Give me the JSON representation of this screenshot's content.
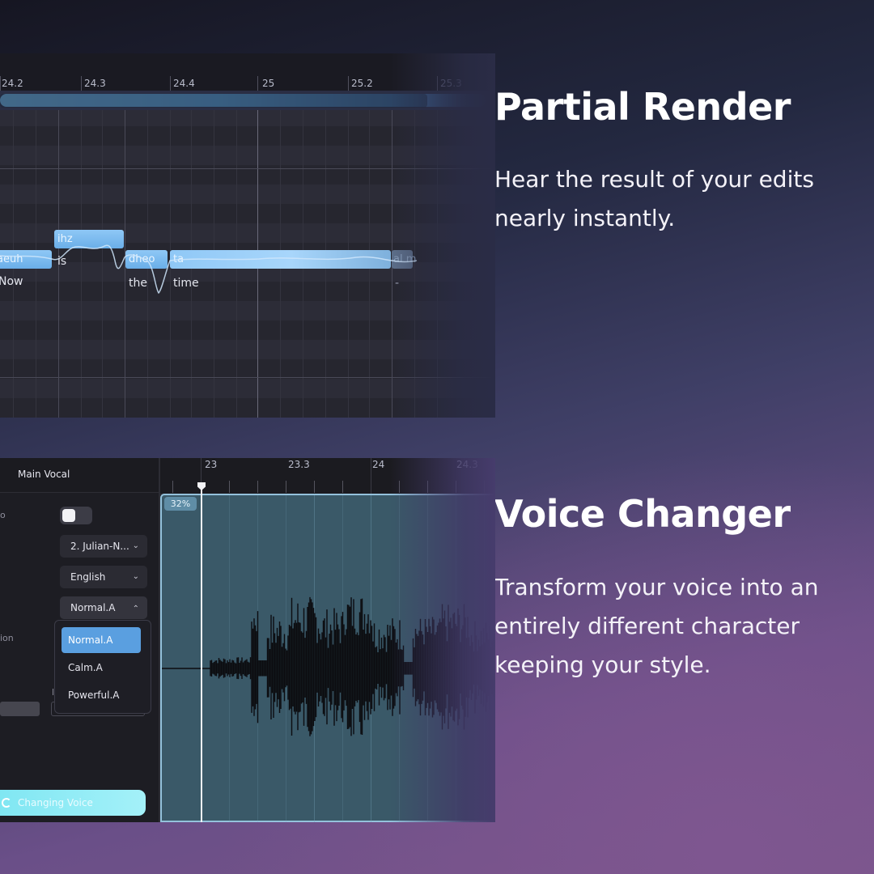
{
  "partial_render": {
    "heading": "Partial Render",
    "description": "Hear the result of your edits nearly instantly.",
    "ruler_ticks": [
      "24.2",
      "24.3",
      "24.4",
      "25",
      "25.2",
      "25.3"
    ],
    "notes": [
      {
        "label": "aeuh"
      },
      {
        "label": "ihz"
      },
      {
        "label": "dheo"
      },
      {
        "label": "ta"
      },
      {
        "label": "al m"
      }
    ],
    "lyrics": [
      "Now",
      "is",
      "the",
      "time",
      "-"
    ]
  },
  "voice_changer": {
    "heading": "Voice Changer",
    "description": "Transform your voice into an entirely different character keeping your style.",
    "track_title": "Main Vocal",
    "partial_labels": [
      "o",
      "ion",
      "l"
    ],
    "voice_select": "2. Julian-N...",
    "language_select": "English",
    "style_select": "Normal.A",
    "style_options": [
      "Normal.A",
      "Calm.A",
      "Powerful.A"
    ],
    "progress_badge": "32%",
    "ruler_ticks": [
      "23",
      "23.3",
      "24",
      "24.3"
    ],
    "action_button": "Changing Voice",
    "icons": {
      "chevron_down": "chevron-down-icon",
      "chevron_up": "chevron-up-icon",
      "spinner": "spinner-icon"
    }
  }
}
